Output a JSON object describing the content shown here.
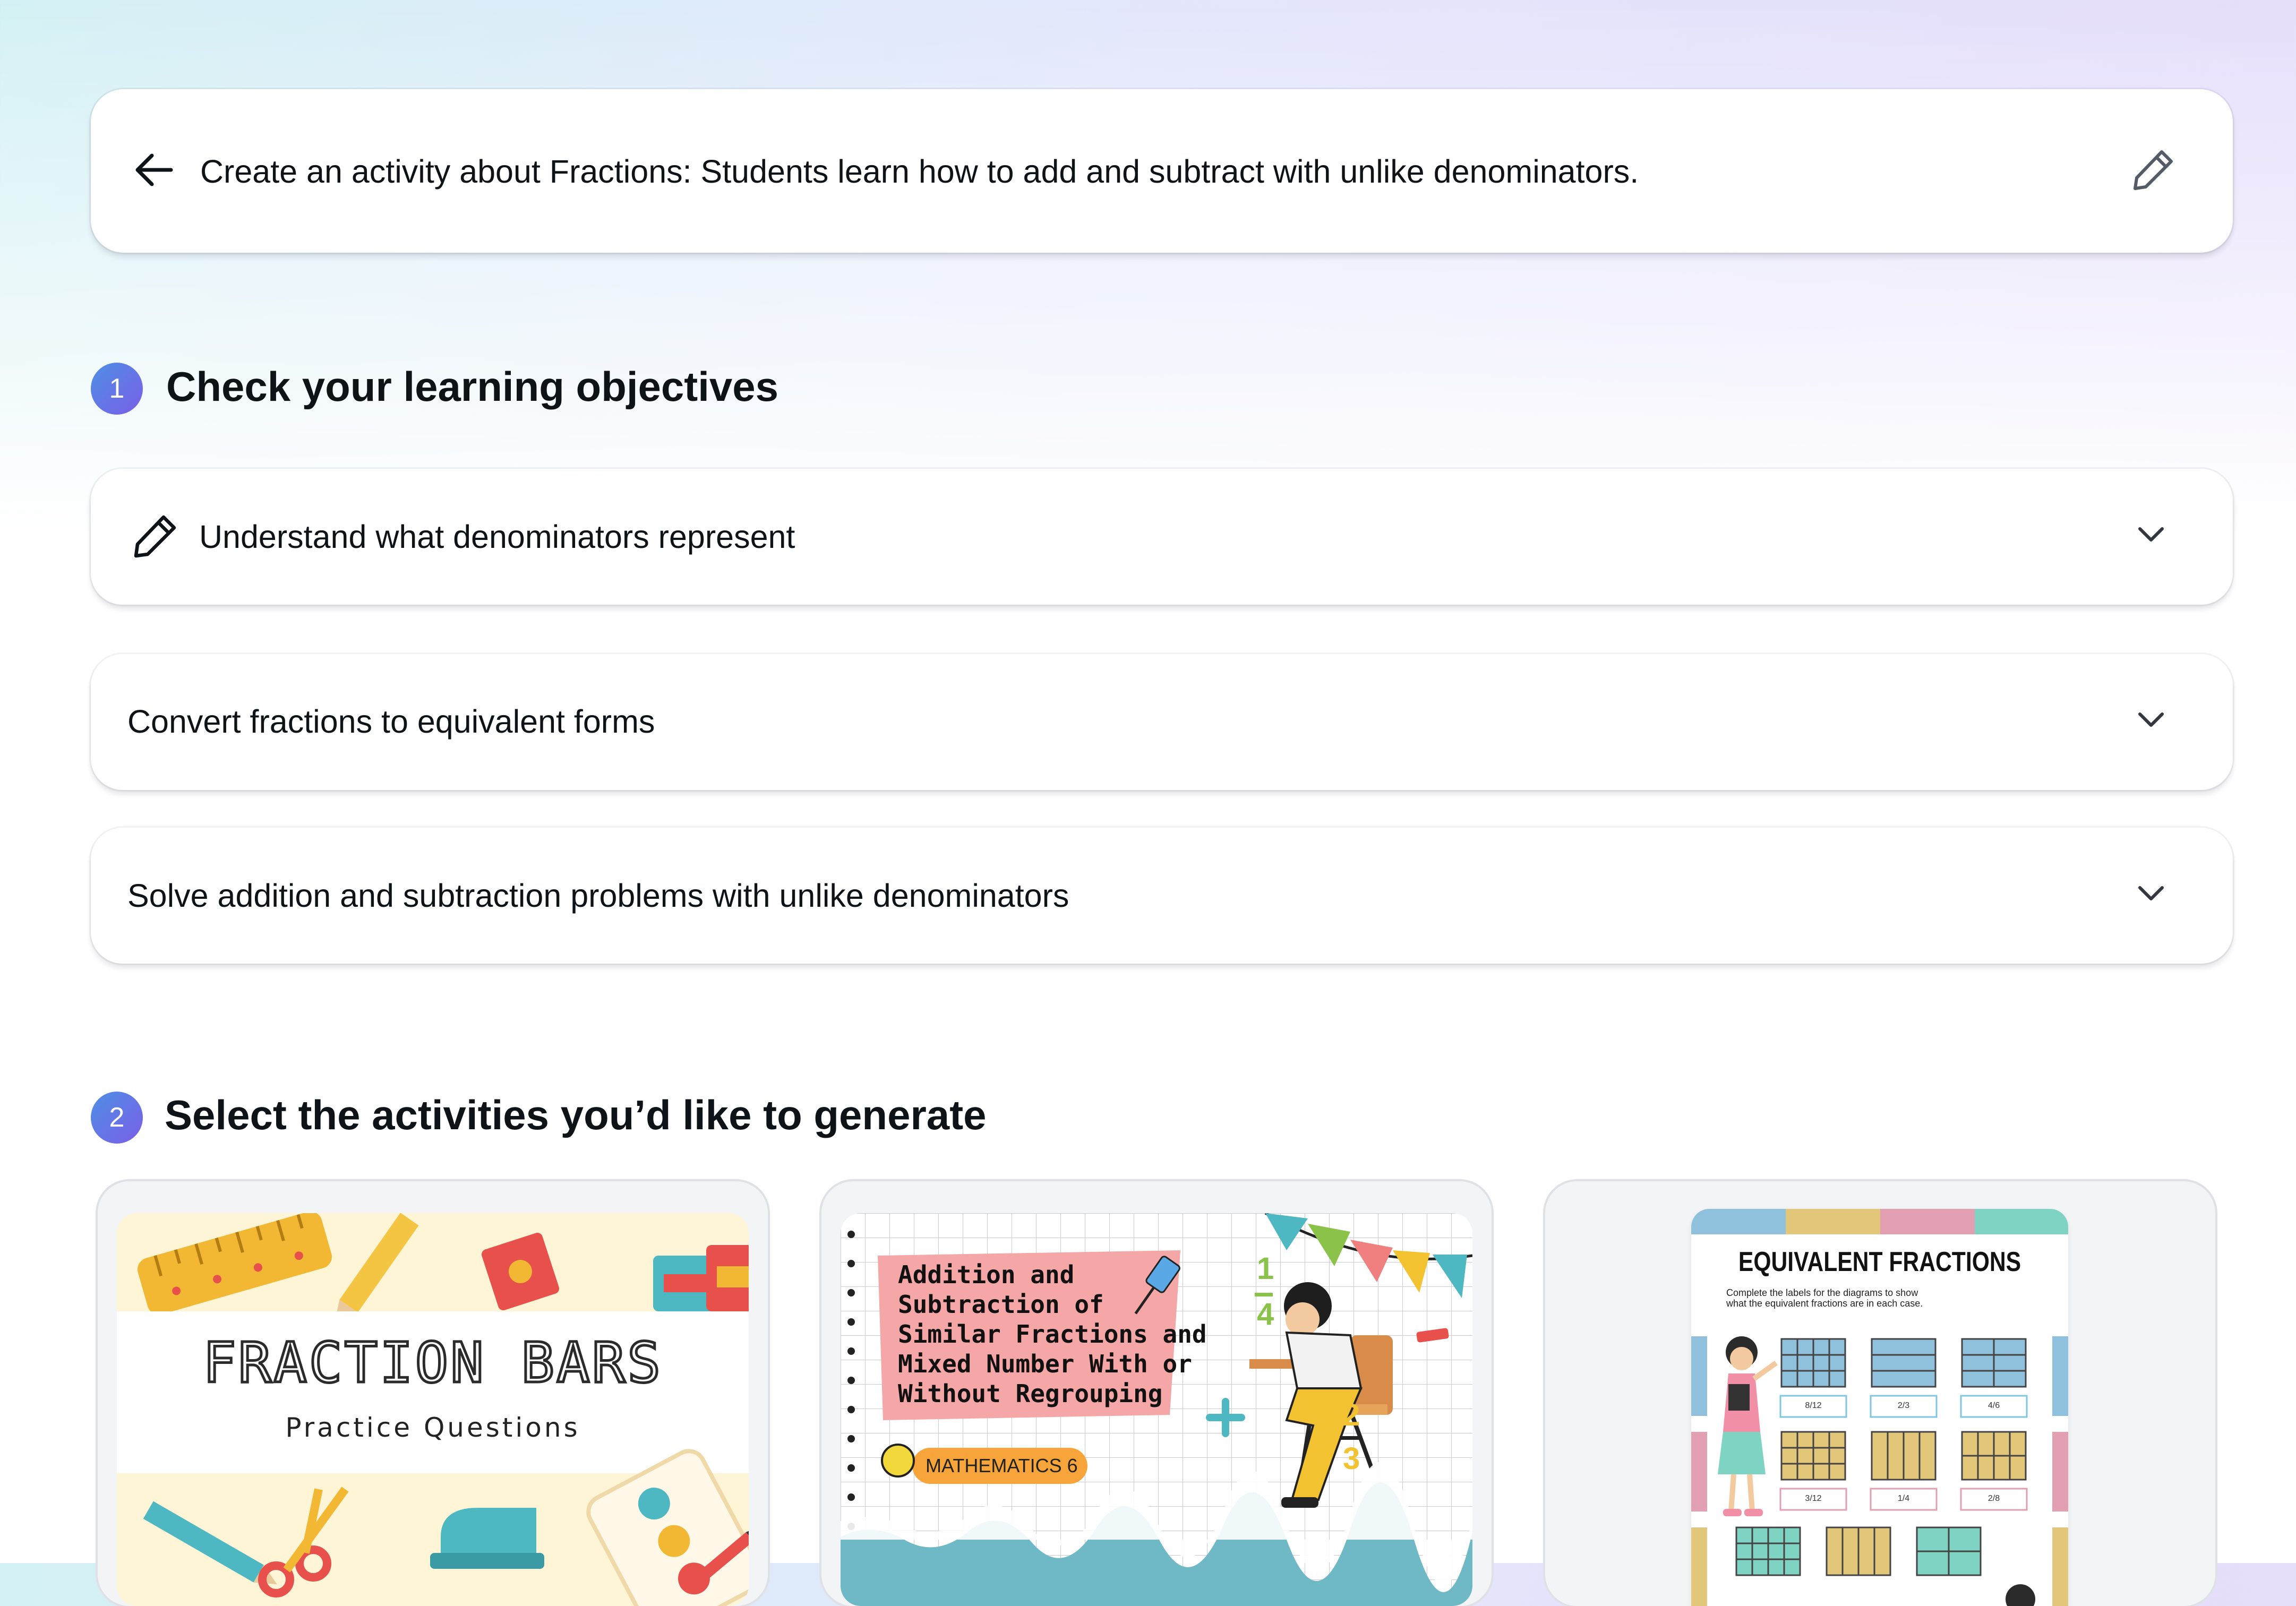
{
  "prompt": {
    "text": "Create an activity about Fractions: Students learn how to add and subtract with unlike denominators.",
    "back_icon": "arrow-left-icon",
    "edit_icon": "pencil-icon"
  },
  "steps": [
    {
      "number": "1",
      "title": "Check your learning objectives"
    },
    {
      "number": "2",
      "title": "Select the activities you’d like to generate"
    }
  ],
  "objectives": [
    {
      "text": "Understand what denominators represent",
      "icon": "pencil-icon",
      "editing": true
    },
    {
      "text": "Convert fractions to equivalent forms"
    },
    {
      "text": "Solve addition and subtraction problems with unlike denominators"
    }
  ],
  "activities": [
    {
      "title": "FRACTION BARS",
      "subtitle": "Practice Questions"
    },
    {
      "title_lines": [
        "Addition and",
        "Subtraction of",
        "Similar Fractions and",
        "Mixed Number With or",
        "Without Regrouping"
      ],
      "tag": "MATHEMATICS 6",
      "side_numbers": [
        "1",
        "4",
        "2",
        "3"
      ]
    },
    {
      "title": "EQUIVALENT FRACTIONS",
      "instructions": [
        "Complete the labels for the diagrams to show",
        "what the equivalent fractions are in each case."
      ],
      "labels_row1": [
        "8/12",
        "2/3",
        "4/6"
      ],
      "labels_row2": [
        "3/12",
        "1/4",
        "2/8"
      ]
    }
  ],
  "colors": {
    "badge_start": "#4d8fe6",
    "badge_end": "#7b5ee6",
    "card": "#ffffff"
  }
}
